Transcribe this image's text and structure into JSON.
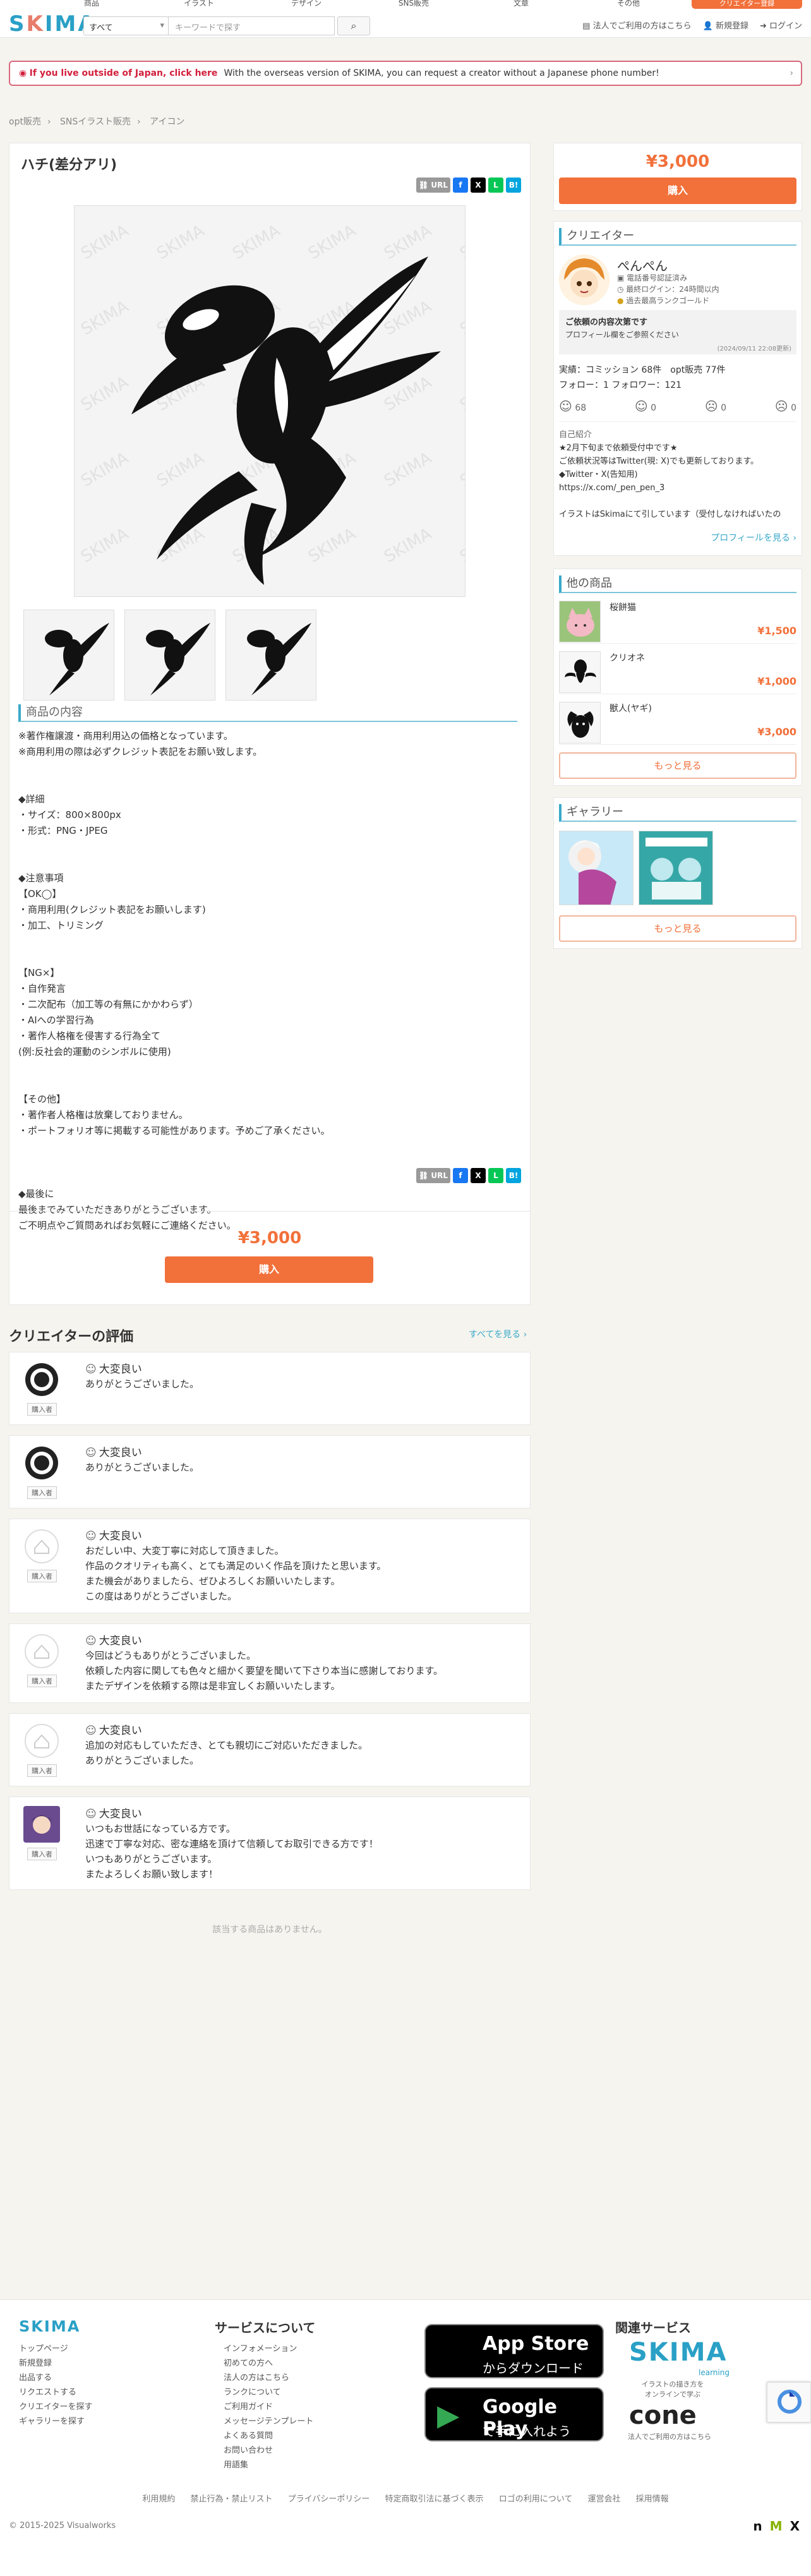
{
  "header": {
    "topnav": [
      "商品",
      "イラスト",
      "デザイン",
      "SNS販売",
      "文章",
      "その他"
    ],
    "top_cta": "クリエイター登録",
    "logo": "SKIMA",
    "search_category": "すべて",
    "search_placeholder": "キーワードで探す",
    "links": [
      "法人でご利用の方はこちら",
      "新規登録",
      "ログイン"
    ]
  },
  "notice": {
    "bold": "If you live outside of Japan, click here",
    "text": "With the overseas version of SKIMA, you can request a creator without a Japanese phone number!"
  },
  "breadcrumb": [
    "opt販売",
    "SNSイラスト販売",
    "アイコン"
  ],
  "product": {
    "title": "ハチ(差分アリ)",
    "url_btn": "URL",
    "share": [
      "f",
      "X",
      "L",
      "B!"
    ],
    "desc_head": "商品の内容",
    "description": "※著作権譲渡・商用利用込の価格となっています。\n※商用利用の際は必ずクレジット表記をお願い致します。\n\n\n◆詳細\n・サイズ：800×800px\n・形式：PNG・JPEG\n\n\n◆注意事項\n【OK◯】\n・商用利用(クレジット表記をお願いします)\n・加工、トリミング\n\n\n【NG×】\n・自作発言\n・二次配布（加工等の有無にかかわらず）\n・AIへの学習行為\n・著作人格権を侵害する行為全て\n(例:反社会的運動のシンボルに使用)\n\n\n【その他】\n・著作者人格権は放棄しておりません。\n・ポートフォリオ等に掲載する可能性があります。予めご了承ください。\n\n\n\n◆最後に\n最後までみていただきありがとうございます。\nご不明点やご質問あればお気軽にご連絡ください。",
    "price": "¥3,000",
    "buy": "購入"
  },
  "sidebar": {
    "price": "¥3,000",
    "buy": "購入",
    "creator_head": "クリエイター",
    "creator_name": "ぺんぺん",
    "badges": [
      "電話番号認証済み",
      "最終ログイン：24時間以内",
      "過去最高ランクゴールド"
    ],
    "request_title": "ご依頼の内容次第です",
    "request_sub": "プロフィール欄をご参照ください",
    "request_date": "(2024/09/11 22:08更新)",
    "stats": "実績：コミッション 68件　opt販売 77件",
    "follow": "フォロー：1 フォロワー：121",
    "ratings": [
      "68",
      "0",
      "0",
      "0"
    ],
    "intro_head": "自己紹介",
    "intro": "★2月下旬まで依頼受付中です★\nご依頼状況等はTwitter(現: X)でも更新しております。\n◆Twitter・X(告知用)\nhttps://x.com/_pen_pen_3\n\nイラストはSkimaにて引しています（受付しなければいたの",
    "profile_link": "プロフィールを見る ›",
    "other_head": "他の商品",
    "other_items": [
      {
        "name": "桜餅猫",
        "price": "¥1,500"
      },
      {
        "name": "クリオネ",
        "price": "¥1,000"
      },
      {
        "name": "獣人(ヤギ)",
        "price": "¥3,000"
      }
    ],
    "more": "もっと見る",
    "gallery_head": "ギャラリー",
    "gallery_more": "もっと見る"
  },
  "reviews": {
    "head": "クリエイターの評価",
    "see_all": "すべてを見る ›",
    "buyer_tag": "購入者",
    "items": [
      {
        "rating": "大変良い",
        "text": "ありがとうございました。"
      },
      {
        "rating": "大変良い",
        "text": "ありがとうございました。"
      },
      {
        "rating": "大変良い",
        "text": "おだしい中、大変丁寧に対応して頂きました。\n作品のクオリティも高く、とても満足のいく作品を頂けたと思います。\nまた機会がありましたら、ぜひよろしくお願いいたします。\nこの度はありがとうございました。"
      },
      {
        "rating": "大変良い",
        "text": "今回はどうもありがとうございました。\n依頼した内容に関しても色々と細かく要望を聞いて下さり本当に感謝しております。\nまたデザインを依頼する際は是非宜しくお願いいたします。"
      },
      {
        "rating": "大変良い",
        "text": "追加の対応もしていただき、とても親切にご対応いただきました。\nありがとうございました。"
      },
      {
        "rating": "大変良い",
        "text": "いつもお世話になっている方です。\n迅速で丁寧な対応、密な連絡を頂けて信頼してお取引できる方です！\nいつもありがとうございます。\nまたよろしくお願い致します！"
      }
    ],
    "no_related": "該当する商品はありません。"
  },
  "footer": {
    "logo": "SKIMA",
    "col1": [
      "トップページ",
      "新規登録",
      "出品する",
      "リクエストする",
      "クリエイターを探す",
      "ギャラリーを探す"
    ],
    "about_head": "サービスについて",
    "col2": [
      "インフォメーション",
      "初めての方へ",
      "法人の方はこちら",
      "ランクについて",
      "ご利用ガイド",
      "メッセージテンプレート",
      "よくある質問",
      "お問い合わせ",
      "用語集"
    ],
    "appstore": {
      "l1": "App Store",
      "l2": "からダウンロード"
    },
    "googleplay": {
      "l1": "Google Play",
      "l2": "で手に入れよう"
    },
    "related_head": "関連サービス",
    "learning_logo": "SKIMA",
    "learning_sub": "learning",
    "learning_desc": "イラストの描き方を\nオンラインで学ぶ",
    "cone": "cone",
    "cone_desc": "法人でご利用の方はこちら",
    "links": [
      "利用規約",
      "禁止行為・禁止リスト",
      "プライバシーポリシー",
      "特定商取引法に基づく表示",
      "ロゴの利用について",
      "運営会社",
      "採用情報"
    ],
    "copyright": "© 2015-2025 Visualworks"
  },
  "colors": {
    "accent": "#f2703a",
    "brand": "#2aa0c6",
    "notice": "#d21f3c"
  }
}
